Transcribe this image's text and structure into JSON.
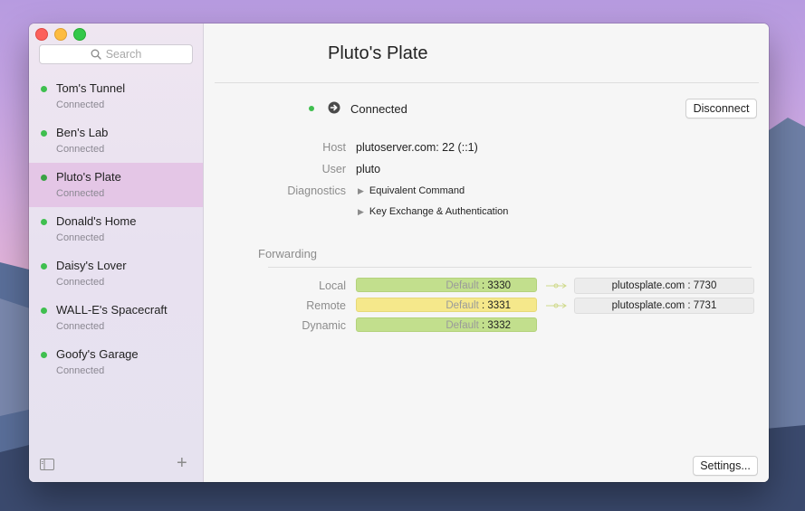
{
  "search": {
    "placeholder": "Search"
  },
  "sidebar": {
    "items": [
      {
        "name": "Tom's Tunnel",
        "status": "Connected"
      },
      {
        "name": "Ben's Lab",
        "status": "Connected"
      },
      {
        "name": "Pluto's Plate",
        "status": "Connected",
        "selected": true
      },
      {
        "name": "Donald's Home",
        "status": "Connected"
      },
      {
        "name": "Daisy's Lover",
        "status": "Connected"
      },
      {
        "name": "WALL-E's Spacecraft",
        "status": "Connected"
      },
      {
        "name": "Goofy's Garage",
        "status": "Connected"
      }
    ],
    "add_label": "+"
  },
  "detail": {
    "title": "Pluto's Plate",
    "status": "Connected",
    "disconnect_label": "Disconnect",
    "host_label": "Host",
    "host_value": "plutoserver.com: 22 (::1)",
    "user_label": "User",
    "user_value": "pluto",
    "diagnostics_label": "Diagnostics",
    "diagnostics": [
      "Equivalent Command",
      "Key Exchange & Authentication"
    ],
    "forwarding_title": "Forwarding",
    "forwarding": [
      {
        "label": "Local",
        "bind": "Default",
        "port": "3330",
        "target": "plutosplate.com : 7730"
      },
      {
        "label": "Remote",
        "bind": "Default",
        "port": "3331",
        "target": "plutosplate.com : 7731"
      },
      {
        "label": "Dynamic",
        "bind": "Default",
        "port": "3332",
        "target": ""
      }
    ],
    "port_separator": ":",
    "settings_label": "Settings..."
  },
  "colors": {
    "connected": "#3fbf4f",
    "local_pill": "#c2df8d",
    "remote_pill": "#f5e88b",
    "selected_row": "#e4c6e6"
  },
  "icons": [
    "search-icon",
    "arrow-circle-icon",
    "disclosure-triangle-icon",
    "sidebar-toggle-icon",
    "plus-icon",
    "link-arrow-icon"
  ]
}
